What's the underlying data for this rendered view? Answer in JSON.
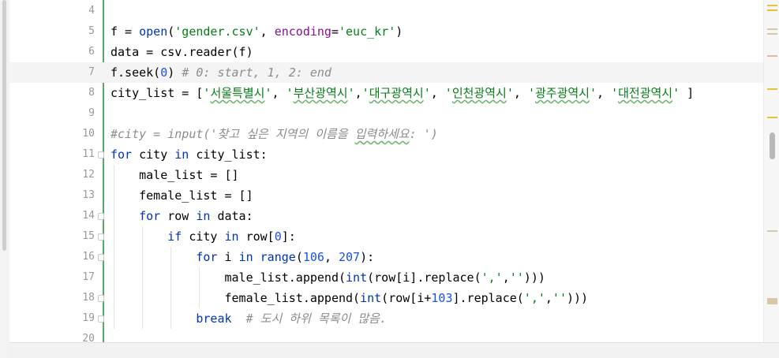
{
  "editor": {
    "lines": [
      {
        "num": "4",
        "tokens": []
      },
      {
        "num": "5",
        "tokens": [
          {
            "t": "f = "
          },
          {
            "t": "open",
            "c": "kw"
          },
          {
            "t": "("
          },
          {
            "t": "'gender.csv'",
            "c": "str"
          },
          {
            "t": ", "
          },
          {
            "t": "encoding",
            "c": "param"
          },
          {
            "t": "="
          },
          {
            "t": "'euc_kr'",
            "c": "str"
          },
          {
            "t": ")"
          }
        ]
      },
      {
        "num": "6",
        "tokens": [
          {
            "t": "data = csv.reader(f)"
          }
        ]
      },
      {
        "num": "7",
        "highlight": true,
        "tokens": [
          {
            "t": "f.seek("
          },
          {
            "t": "0",
            "c": "num"
          },
          {
            "t": ") "
          },
          {
            "t": "# 0: start, 1, 2: end",
            "c": "cmt"
          }
        ]
      },
      {
        "num": "8",
        "tokens": [
          {
            "t": "city_list = ["
          },
          {
            "t": "'",
            "c": "str"
          },
          {
            "t": "서울특별시",
            "c": "str ko"
          },
          {
            "t": "'",
            "c": "str"
          },
          {
            "t": ", "
          },
          {
            "t": "'",
            "c": "str"
          },
          {
            "t": "부산광역시",
            "c": "str ko"
          },
          {
            "t": "'",
            "c": "str"
          },
          {
            "t": ","
          },
          {
            "t": "'",
            "c": "str"
          },
          {
            "t": "대구광역시",
            "c": "str ko"
          },
          {
            "t": "'",
            "c": "str"
          },
          {
            "t": ", "
          },
          {
            "t": "'",
            "c": "str"
          },
          {
            "t": "인천광역시",
            "c": "str ko"
          },
          {
            "t": "'",
            "c": "str"
          },
          {
            "t": ", "
          },
          {
            "t": "'",
            "c": "str"
          },
          {
            "t": "광주광역시",
            "c": "str ko"
          },
          {
            "t": "'",
            "c": "str"
          },
          {
            "t": ", "
          },
          {
            "t": "'",
            "c": "str"
          },
          {
            "t": "대전광역시",
            "c": "str ko"
          },
          {
            "t": "'",
            "c": "str"
          },
          {
            "t": " ]"
          }
        ]
      },
      {
        "num": "9",
        "tokens": []
      },
      {
        "num": "10",
        "tokens": [
          {
            "t": "#city = input('찾고 싶은 지역의 이름을 ",
            "c": "cmt"
          },
          {
            "t": "입력하세요",
            "c": "cmt ko"
          },
          {
            "t": ": ')",
            "c": "cmt"
          }
        ]
      },
      {
        "num": "11",
        "fold": true,
        "tokens": [
          {
            "t": "for",
            "c": "kw"
          },
          {
            "t": " city "
          },
          {
            "t": "in",
            "c": "kw"
          },
          {
            "t": " city_list:"
          }
        ]
      },
      {
        "num": "12",
        "indent": 1,
        "tokens": [
          {
            "t": "    male_list = []"
          }
        ]
      },
      {
        "num": "13",
        "indent": 1,
        "tokens": [
          {
            "t": "    female_list = []"
          }
        ]
      },
      {
        "num": "14",
        "fold": true,
        "indent": 1,
        "tokens": [
          {
            "t": "    "
          },
          {
            "t": "for",
            "c": "kw"
          },
          {
            "t": " row "
          },
          {
            "t": "in",
            "c": "kw"
          },
          {
            "t": " data:"
          }
        ]
      },
      {
        "num": "15",
        "fold": true,
        "indent": 2,
        "tokens": [
          {
            "t": "        "
          },
          {
            "t": "if",
            "c": "kw"
          },
          {
            "t": " city "
          },
          {
            "t": "in",
            "c": "kw"
          },
          {
            "t": " row["
          },
          {
            "t": "0",
            "c": "num"
          },
          {
            "t": "]:"
          }
        ]
      },
      {
        "num": "16",
        "fold": true,
        "indent": 3,
        "tokens": [
          {
            "t": "            "
          },
          {
            "t": "for",
            "c": "kw"
          },
          {
            "t": " i "
          },
          {
            "t": "in",
            "c": "kw"
          },
          {
            "t": " "
          },
          {
            "t": "range",
            "c": "kw"
          },
          {
            "t": "("
          },
          {
            "t": "106",
            "c": "num"
          },
          {
            "t": ", "
          },
          {
            "t": "207",
            "c": "num"
          },
          {
            "t": "):"
          }
        ]
      },
      {
        "num": "17",
        "indent": 4,
        "tokens": [
          {
            "t": "                male_list.append("
          },
          {
            "t": "int",
            "c": "kw"
          },
          {
            "t": "(row[i].replace("
          },
          {
            "t": "','",
            "c": "str"
          },
          {
            "t": ","
          },
          {
            "t": "''",
            "c": "str"
          },
          {
            "t": ")))"
          }
        ]
      },
      {
        "num": "18",
        "fold": true,
        "indent": 4,
        "tokens": [
          {
            "t": "                female_list.append("
          },
          {
            "t": "int",
            "c": "kw"
          },
          {
            "t": "(row[i+"
          },
          {
            "t": "103",
            "c": "num"
          },
          {
            "t": "].replace("
          },
          {
            "t": "','",
            "c": "str"
          },
          {
            "t": ","
          },
          {
            "t": "''",
            "c": "str"
          },
          {
            "t": ")))"
          }
        ]
      },
      {
        "num": "19",
        "fold": true,
        "indent": 3,
        "tokens": [
          {
            "t": "            "
          },
          {
            "t": "break",
            "c": "kw"
          },
          {
            "t": "  "
          },
          {
            "t": "# 도시 하위 목록이 많음.",
            "c": "cmt"
          }
        ]
      },
      {
        "num": "20",
        "tokens": []
      }
    ]
  },
  "right_panel": {
    "markers": [
      {
        "color": "#e8c23a"
      },
      {
        "color": "#e8c23a"
      },
      {
        "color": "#d9c7a7"
      },
      {
        "color": "#d9c7a7"
      },
      {
        "color": "#e8b7a0"
      },
      {
        "color": "#e8c23a"
      },
      {
        "color": "#e8c23a"
      },
      {
        "color": "#d9c7a7"
      },
      {
        "color": "#d9c7a7"
      }
    ]
  }
}
